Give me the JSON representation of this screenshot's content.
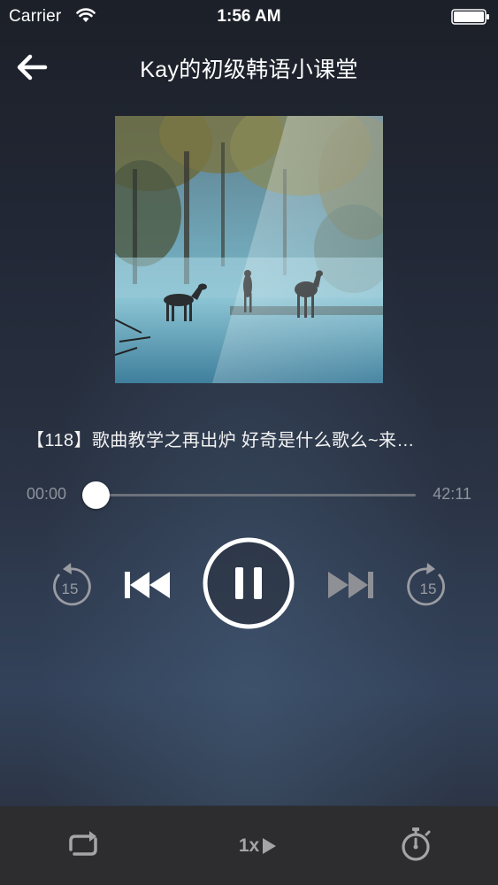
{
  "status_bar": {
    "carrier": "Carrier",
    "time": "1:56 AM"
  },
  "nav": {
    "title": "Kay的初级韩语小课堂"
  },
  "episode": {
    "title": "【118】歌曲教学之再出炉 好奇是什么歌么~来…"
  },
  "player": {
    "current_time": "00:00",
    "total_time": "42:11",
    "progress_fraction": 0.0,
    "state": "playing",
    "skip_back_seconds": "15",
    "skip_forward_seconds": "15"
  },
  "toolbar": {
    "speed_label": "1x"
  },
  "icons": {
    "back": "arrow-left-icon",
    "wifi": "wifi-icon",
    "battery": "battery-icon",
    "rewind": "rewind-15-icon",
    "previous": "skip-previous-icon",
    "pause": "pause-icon",
    "next": "skip-next-icon",
    "forward": "forward-15-icon",
    "repeat": "repeat-icon",
    "timer": "stopwatch-icon"
  },
  "colors": {
    "background_top": "#1c2028",
    "background_bottom": "#33425a",
    "toolbar_bg": "#2d2d2f",
    "muted_text": "#8e939c",
    "accent": "#ffffff"
  }
}
